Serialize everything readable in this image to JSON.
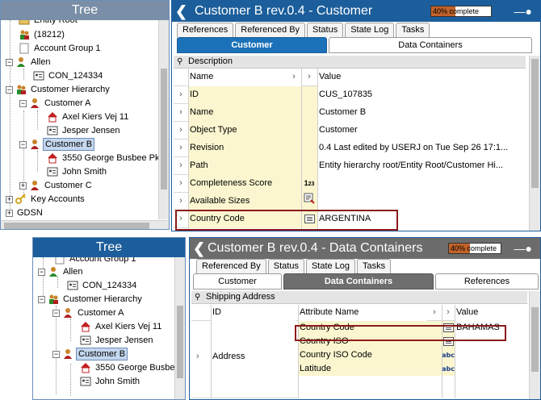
{
  "top": {
    "tree": {
      "title": "Tree",
      "items": [
        {
          "label": "Entity Root"
        },
        {
          "label": "(18212)"
        },
        {
          "label": "Account Group 1"
        },
        {
          "label": "Allen"
        },
        {
          "label": "CON_124334"
        },
        {
          "label": "Customer Hierarchy"
        },
        {
          "label": "Customer A"
        },
        {
          "label": "Axel Kiers Vej 11"
        },
        {
          "label": "Jesper Jensen"
        },
        {
          "label": "Customer B"
        },
        {
          "label": "3550 George Busbee Pk"
        },
        {
          "label": "John Smith"
        },
        {
          "label": "Customer C"
        },
        {
          "label": "Key Accounts"
        },
        {
          "label": "GDSN"
        }
      ]
    },
    "object": {
      "title": "Customer B rev.0.4 - Customer",
      "progress_text": "40% complete",
      "progress_value": 0.4,
      "tabs": [
        "References",
        "Referenced By",
        "Status",
        "State Log",
        "Tasks"
      ],
      "subtabs": [
        "Customer",
        "Data Containers"
      ],
      "group_label": "Description",
      "columns": {
        "name": "Name",
        "value": "Value"
      },
      "rows": [
        {
          "name": "ID",
          "value": "CUS_107835",
          "icon": ""
        },
        {
          "name": "Name",
          "value": "Customer B",
          "icon": ""
        },
        {
          "name": "Object Type",
          "value": "Customer",
          "icon": ""
        },
        {
          "name": "Revision",
          "value": "0.4 Last edited by USERJ on Tue Sep 26 17:1...",
          "icon": ""
        },
        {
          "name": "Path",
          "value": "Entity hierarchy root/Entity Root/Customer Hi...",
          "icon": ""
        },
        {
          "name": "Completeness Score",
          "value": "",
          "icon": "score-icon"
        },
        {
          "name": "Available Sizes",
          "value": "",
          "icon": "list-edit-icon"
        },
        {
          "name": "Country Code",
          "value": "ARGENTINA",
          "icon": "list-icon"
        }
      ]
    }
  },
  "bottom": {
    "tree": {
      "title": "Tree",
      "items": [
        {
          "label": "Account Group 1"
        },
        {
          "label": "Allen"
        },
        {
          "label": "CON_124334"
        },
        {
          "label": "Customer Hierarchy"
        },
        {
          "label": "Customer A"
        },
        {
          "label": "Axel Kiers Vej 11"
        },
        {
          "label": "Jesper Jensen"
        },
        {
          "label": "Customer B"
        },
        {
          "label": "3550 George Busbe"
        },
        {
          "label": "John Smith"
        }
      ]
    },
    "object": {
      "title": "Customer B rev.0.4 - Data Containers",
      "progress_text": "40% complete",
      "progress_value": 0.4,
      "tabs": [
        "Referenced By",
        "Status",
        "State Log",
        "Tasks"
      ],
      "subtabs": [
        "Customer",
        "Data Containers",
        "References"
      ],
      "group_label": "Shipping Address",
      "columns": {
        "id": "ID",
        "attr": "Attribute Name",
        "value": "Value"
      },
      "container_id": "Address",
      "rows": [
        {
          "name": "Country Code",
          "value": "BAHAMAS",
          "icon": "list-icon"
        },
        {
          "name": "Country ISO",
          "value": "",
          "icon": "list-icon"
        },
        {
          "name": "Country ISO Code",
          "value": "",
          "icon": "abc-icon"
        },
        {
          "name": "Latitude",
          "value": "",
          "icon": "abc-icon"
        }
      ]
    }
  },
  "colors": {
    "header_blue": "#1c5e9b",
    "tree_header": "#7a8fa7",
    "name_cell": "#fbf6cf",
    "highlight": "#8b1a1a",
    "progress_fill": "#c0622a"
  },
  "icon_names": {
    "group": "users-group-icon",
    "person": "person-icon",
    "address": "house-icon",
    "contact": "contact-card-icon",
    "key": "key-icon",
    "folder": "folder-icon",
    "doc": "document-icon"
  }
}
